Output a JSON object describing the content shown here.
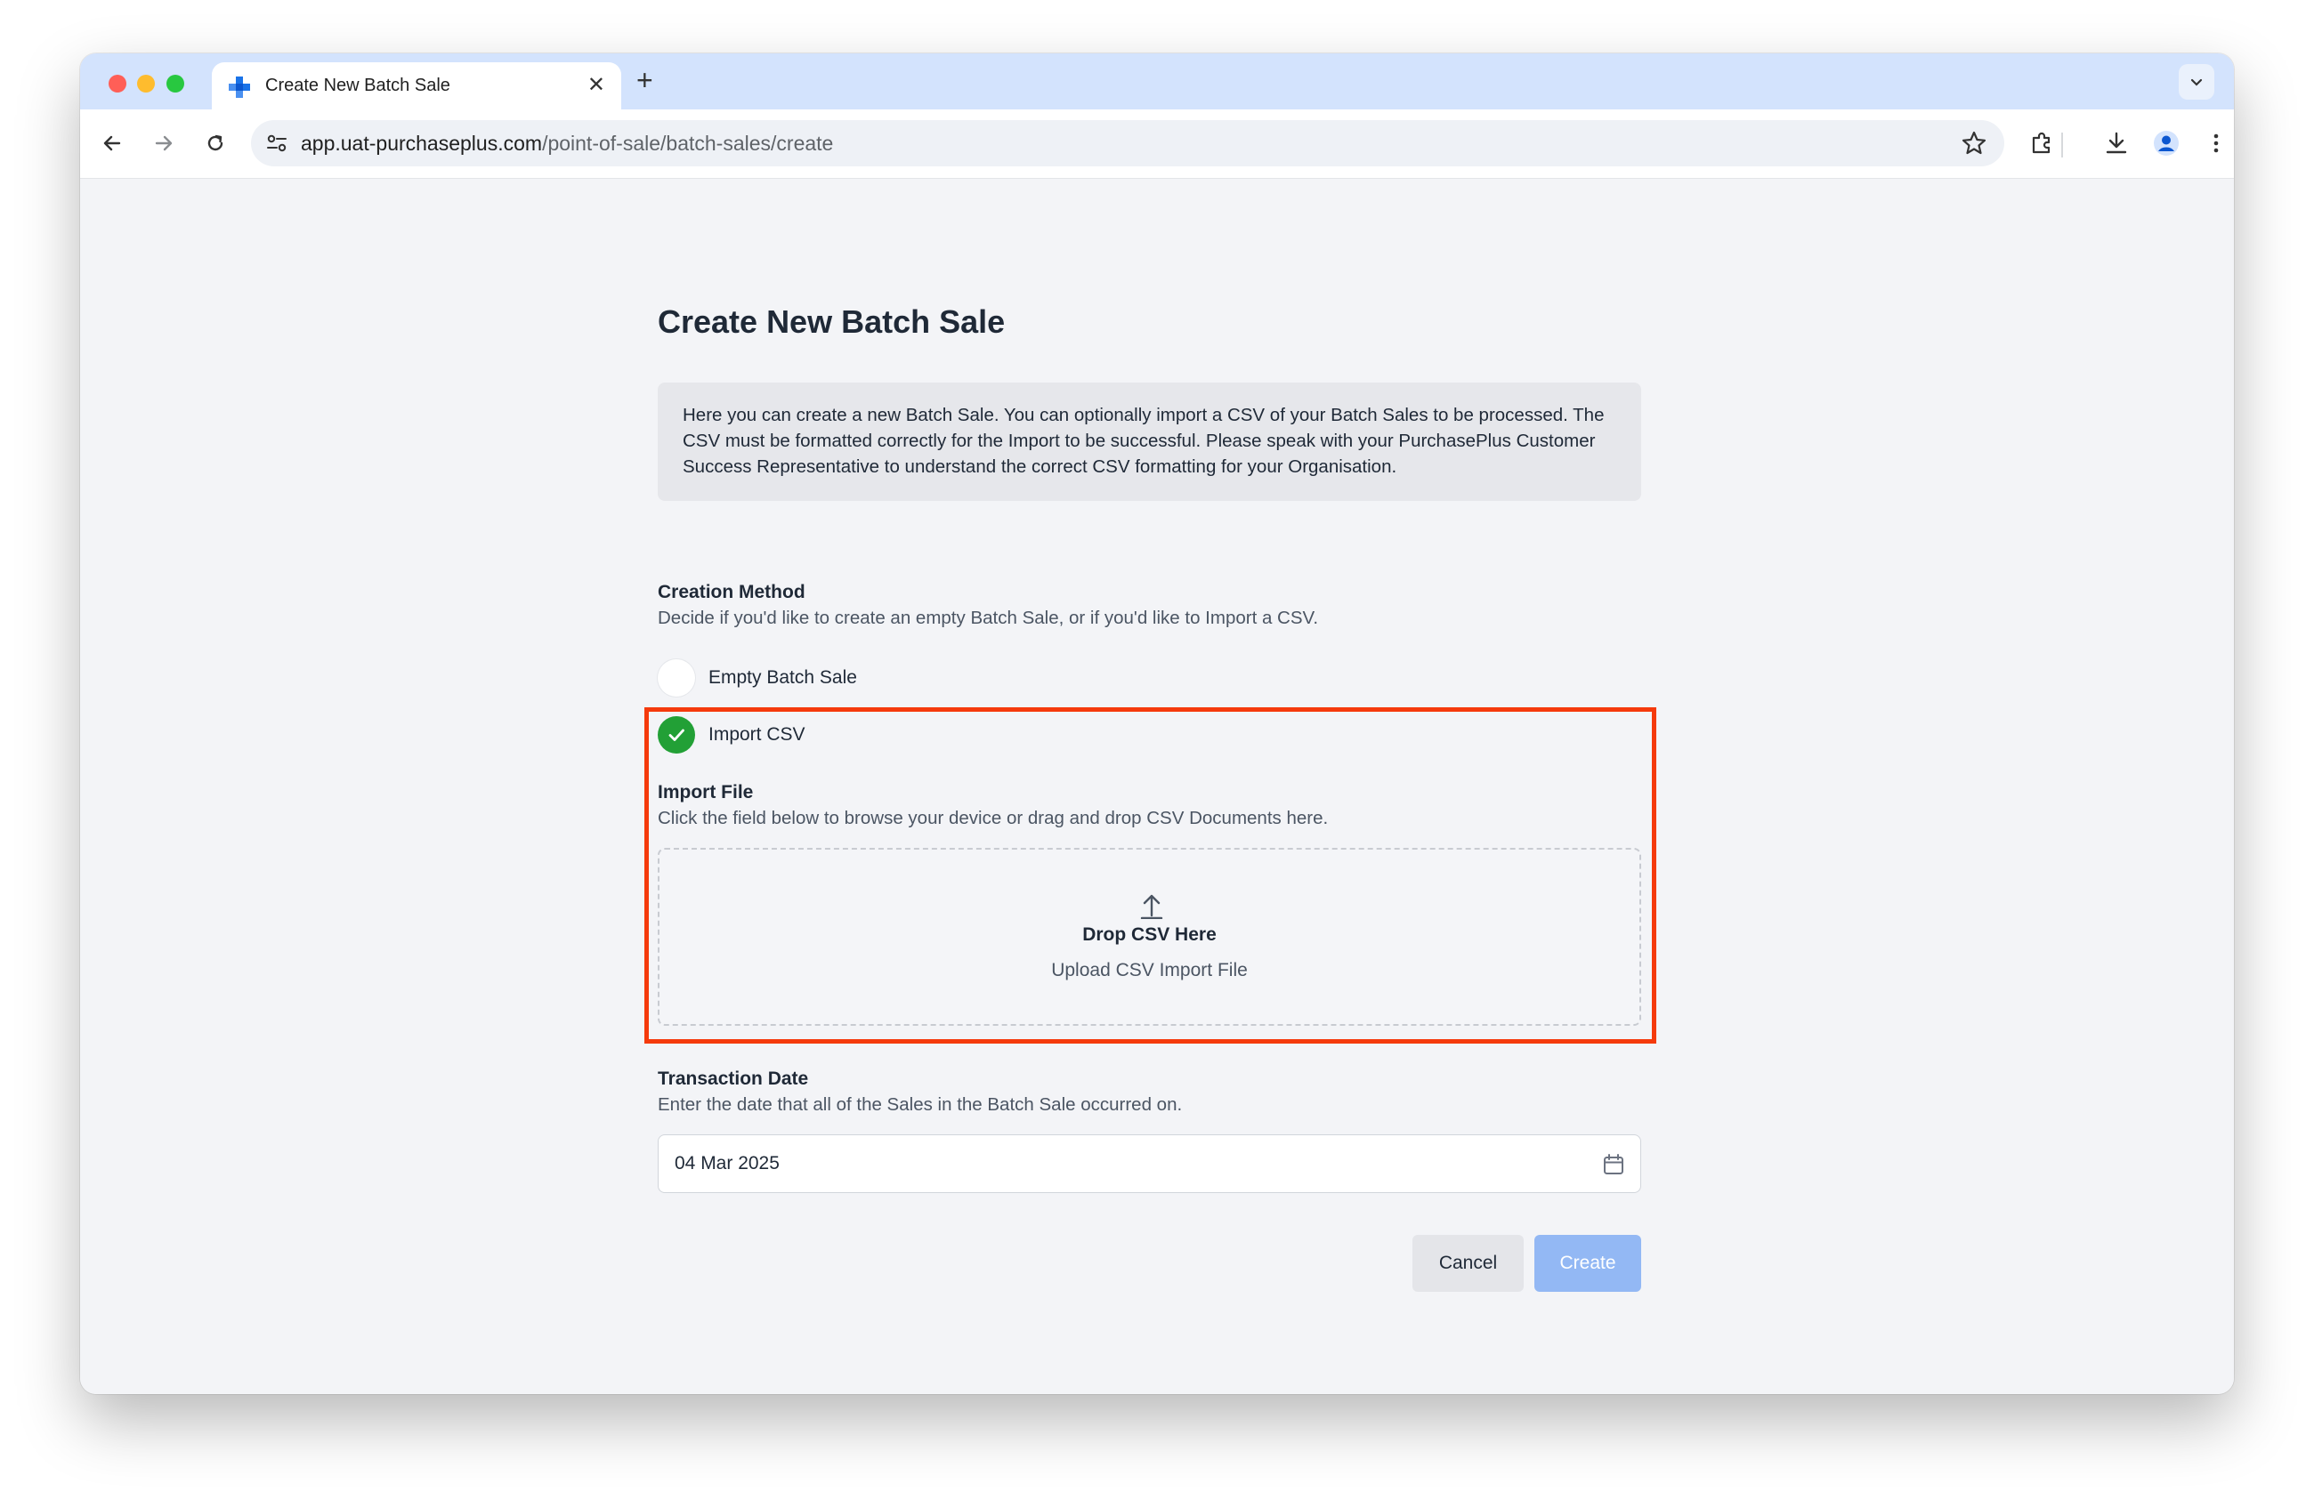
{
  "browser": {
    "tab_title": "Create New Batch Sale",
    "tab_close": "✕",
    "new_tab": "+",
    "url_host": "app.uat-purchaseplus.com",
    "url_path": "/point-of-sale/batch-sales/create"
  },
  "page": {
    "title": "Create New Batch Sale",
    "info_text": "Here you can create a new Batch Sale. You can optionally import a CSV of your Batch Sales to be processed. The CSV must be formatted correctly for the Import to be successful. Please speak with your PurchasePlus Customer Success Representative to understand the correct CSV formatting for your Organisation."
  },
  "creation_method": {
    "label": "Creation Method",
    "description": "Decide if you'd like to create an empty Batch Sale, or if you'd like to Import a CSV.",
    "options": [
      {
        "label": "Empty Batch Sale",
        "selected": false
      },
      {
        "label": "Import CSV",
        "selected": true
      }
    ]
  },
  "import_file": {
    "label": "Import File",
    "description": "Click the field below to browse your device or drag and drop CSV Documents here.",
    "drop_title": "Drop CSV Here",
    "drop_subtitle": "Upload CSV Import File"
  },
  "transaction_date": {
    "label": "Transaction Date",
    "description": "Enter the date that all of the Sales in the Batch Sale occurred on.",
    "value": "04 Mar 2025"
  },
  "actions": {
    "cancel_label": "Cancel",
    "create_label": "Create"
  },
  "colors": {
    "accent_green": "#22a036",
    "highlight_red": "#f53a0c",
    "create_button": "#93b8f4"
  }
}
